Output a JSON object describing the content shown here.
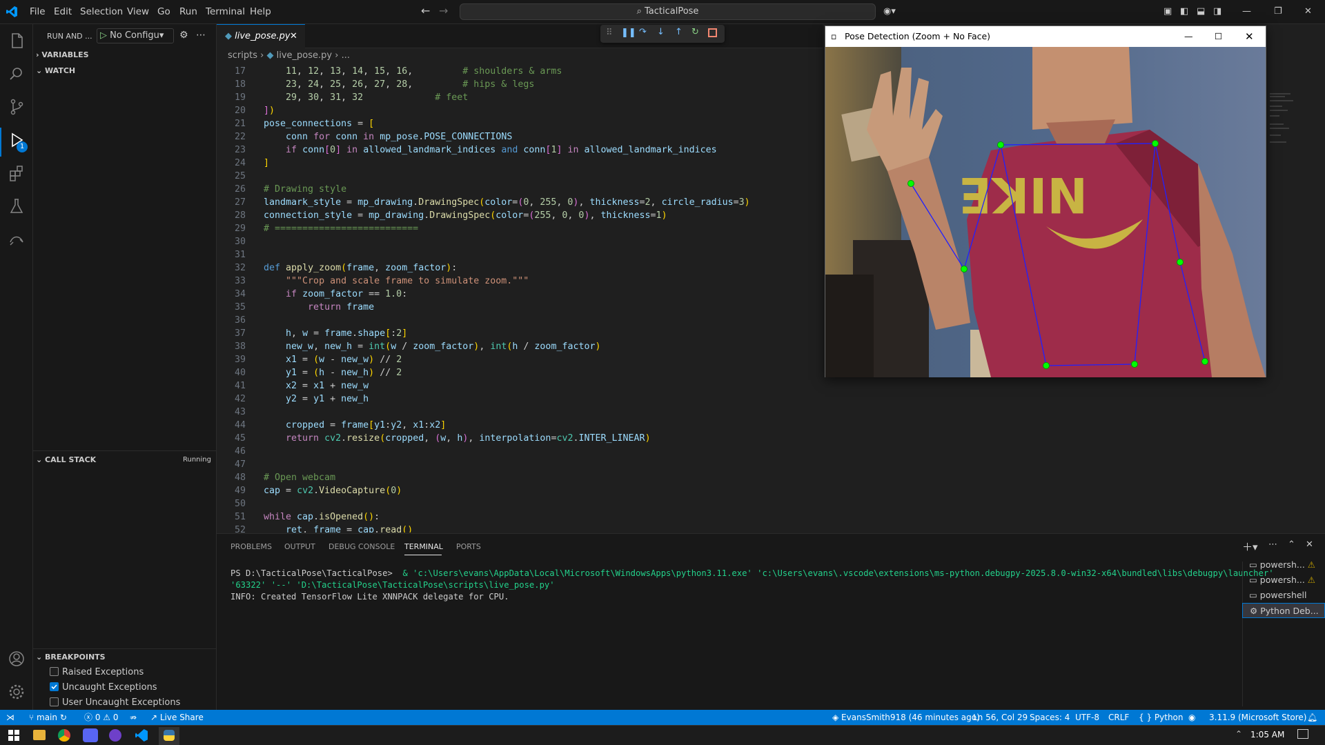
{
  "titlebar": {
    "menus": [
      "File",
      "Edit",
      "Selection",
      "View",
      "Go",
      "Run",
      "Terminal",
      "Help"
    ],
    "search_text": "TacticalPose"
  },
  "sidebar": {
    "run_label": "RUN AND ...",
    "config": "No Configu",
    "variables": "VARIABLES",
    "watch": "WATCH",
    "call_stack": "CALL STACK",
    "call_stack_status": "Running",
    "breakpoints": "BREAKPOINTS",
    "bp_items": [
      {
        "label": "Raised Exceptions",
        "checked": false
      },
      {
        "label": "Uncaught Exceptions",
        "checked": true
      },
      {
        "label": "User Uncaught Exceptions",
        "checked": false
      }
    ],
    "debug_badge": "1"
  },
  "editor": {
    "tab": "live_pose.py",
    "breadcrumb": [
      "scripts",
      "live_pose.py",
      "..."
    ],
    "lines": [
      "17",
      "18",
      "19",
      "20",
      "21",
      "22",
      "23",
      "24",
      "25",
      "26",
      "27",
      "28",
      "29",
      "30",
      "31",
      "32",
      "33",
      "34",
      "35",
      "36",
      "37",
      "38",
      "39",
      "40",
      "41",
      "42",
      "43",
      "44",
      "45",
      "46",
      "47",
      "48",
      "49",
      "50",
      "51",
      "52"
    ]
  },
  "panel": {
    "tabs": [
      "PROBLEMS",
      "OUTPUT",
      "DEBUG CONSOLE",
      "TERMINAL",
      "PORTS"
    ],
    "active_tab": "TERMINAL",
    "term_prompt": "PS D:\\TacticalPose\\TacticalPose> ",
    "term_cmd1": " & 'c:\\Users\\evans\\AppData\\Local\\Microsoft\\WindowsApps\\python3.11.exe' 'c:\\Users\\evans\\.vscode\\extensions\\ms-python.debugpy-2025.8.0-win32-x64\\bundled\\libs\\debugpy\\launcher'",
    "term_cmd2": "'63322' '--' 'D:\\TacticalPose\\TacticalPose\\scripts\\live_pose.py'",
    "term_info": "INFO: Created TensorFlow Lite XNNPACK delegate for CPU.",
    "terminals": [
      "powersh...",
      "powersh...",
      "powershell",
      "Python Deb..."
    ]
  },
  "status": {
    "branch": "main",
    "errors": "0",
    "warnings": "0",
    "live_share": "Live Share",
    "author": "EvansSmith918 (46 minutes ago)",
    "position": "Ln 56, Col 29",
    "spaces": "Spaces: 4",
    "encoding": "UTF-8",
    "eol": "CRLF",
    "language": "Python",
    "interpreter": "3.11.9 (Microsoft Store)"
  },
  "pose_window": {
    "title": "Pose Detection (Zoom + No Face)"
  },
  "taskbar": {
    "time": "1:05 AM"
  },
  "colors": {
    "accent": "#0078d4",
    "landmark": "#00ff00",
    "connection": "#0000ff"
  }
}
